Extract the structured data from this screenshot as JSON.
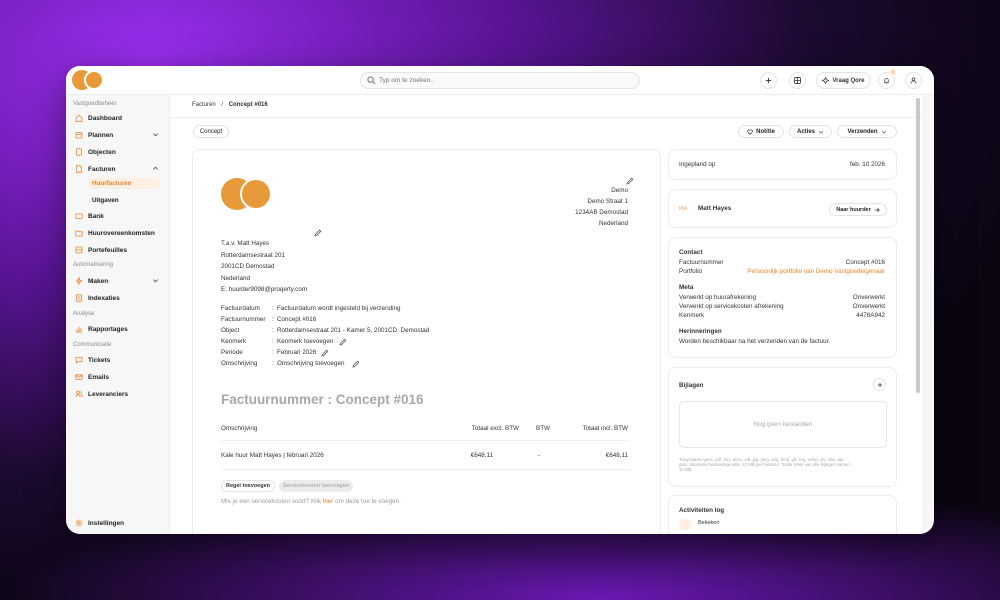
{
  "colors": {
    "accent": "#e8842a",
    "brand_logo": "#e89a3a",
    "background_gradient": "#7b22c8"
  },
  "topbar": {
    "search_placeholder": "Typ om te zoeken..",
    "ask_label": "Vraag Qore",
    "notification_count": "0",
    "icons": [
      "plus-icon",
      "grid-icon",
      "sparkle-icon",
      "bell-icon",
      "user-icon"
    ]
  },
  "sidebar": {
    "sections": {
      "vastgoedbeheer": "Vastgoedbeheer",
      "automatisering": "Automatisering",
      "analyse": "Analyse",
      "communicatie": "Communicatie"
    },
    "items": {
      "dashboard": "Dashboard",
      "plannen": "Plannen",
      "objecten": "Objecten",
      "facturen": "Facturen",
      "huurfacturen": "Huurfacturen",
      "uitgaven": "Uitgaven",
      "bank": "Bank",
      "huurovereenkomsten": "Huurovereenkomsten",
      "portefeuilles": "Portefeuilles",
      "maken": "Maken",
      "indexaties": "Indexaties",
      "rapportages": "Rapportages",
      "tickets": "Tickets",
      "emails": "Emails",
      "leveranciers": "Leveranciers",
      "instellingen": "Instellingen"
    },
    "active_item": "Huurfacturen"
  },
  "breadcrumb": {
    "parent": "Facturen",
    "separator": "/",
    "current": "Concept #016"
  },
  "status_pill": "Concept",
  "actions": {
    "notitie": "Notitie",
    "acties": "Acties",
    "verzenden": "Verzenden"
  },
  "invoice": {
    "sender": {
      "name": "Demo",
      "street": "Demo Straat 1",
      "postal_city": "1234AB Demostad",
      "country": "Nederland"
    },
    "recipient": {
      "attn": "T.a.v. Matt Hayes",
      "street": "Rotterdamsestraat 201",
      "postal_city": "2001CD Demostad",
      "country": "Nederland",
      "email": "E: huurder9098@proqerty.com"
    },
    "details": [
      {
        "label": "Factuurdatum",
        "value": "Factuurdatum wordt ingesteld bij verzending"
      },
      {
        "label": "Factuurnummer",
        "value": "Concept #016"
      },
      {
        "label": "Object",
        "value": "Rotterdamsestraat 201 - Kamer 5, 2001CD, Demostad"
      },
      {
        "label": "Kenmerk",
        "value": "Kenmerk toevoegen"
      },
      {
        "label": "Periode",
        "value": "Februari 2026"
      },
      {
        "label": "Omschrijving",
        "value": "Omschrijving toevoegen"
      }
    ],
    "detail_separator": ":",
    "title": "Factuurnummer : Concept #016",
    "table": {
      "headers": [
        "Omschrijving",
        "Totaal excl. BTW",
        "BTW",
        "Totaal incl. BTW"
      ],
      "rows": [
        {
          "description": "Kale huur Matt Hayes | februari 2026",
          "excl": "€648,11",
          "btw": "-",
          "incl": "€648,11"
        }
      ]
    },
    "add_line_button": "Regel toevoegen",
    "add_service_button": "Servicekosten toevoegen",
    "hint_before": "Mis je een servicekosten soort? Klik ",
    "hint_link": "hier",
    "hint_after": " om deze toe te voegen."
  },
  "right_panel": {
    "planned": {
      "label": "Ingepland op",
      "value": "feb. 10 2026"
    },
    "tenant": {
      "initials": "MA",
      "name": "Matt Hayes",
      "button": "Naar huurder"
    },
    "contact": {
      "title": "Contact",
      "rows": [
        {
          "label": "Factuurnummer",
          "value": "Concept #016"
        },
        {
          "label": "Portfolio",
          "value": "Persoonlijk portfolio van Demo Vastgoedeigenaar"
        }
      ]
    },
    "meta": {
      "title": "Meta",
      "rows": [
        {
          "label": "Verwerkt op huurafrekening",
          "value": "Onverwerkt"
        },
        {
          "label": "Verwerkt op servicekosten afrekening",
          "value": "Onverwerkt"
        },
        {
          "label": "Kenmerk",
          "value": "4478A942"
        }
      ]
    },
    "reminders": {
      "title": "Herinneringen",
      "text": "Worden beschikbaar na het verzenden van de factuur."
    },
    "attachments": {
      "title": "Bijlagen",
      "empty": "Nog geen bestanden",
      "allowed_line1": "Toegestane types: pdf, doc, docx, odt, jpg, jpeg, png, bmp, gif, svg, webp, xls, xlsx, ppt,",
      "allowed_line2": "pptx. Maximale bestandsgrootte: 10 MB per bestand. Totale limiet van alle bijlagen samen:",
      "allowed_line3": "10 MB."
    },
    "activity": {
      "title": "Activiteiten log",
      "first_item": "Bekeken"
    }
  }
}
